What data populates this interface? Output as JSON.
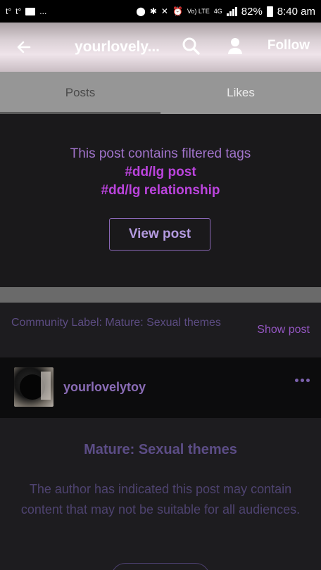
{
  "status_bar": {
    "left_icons": [
      "t-notification-icon",
      "t-notification-icon",
      "folder-icon",
      "more-icon"
    ],
    "left_texts": [
      "t°",
      "t°",
      "..."
    ],
    "battery": "82%",
    "time": "8:40 am",
    "network": "4G",
    "volte": "Vo) LTE"
  },
  "header": {
    "title": "yourlovely...",
    "follow_label": "Follow"
  },
  "tabs": [
    {
      "label": "Posts",
      "active": true
    },
    {
      "label": "Likes",
      "active": false
    }
  ],
  "filtered_post": {
    "message": "This post contains filtered tags",
    "tags": [
      "#dd/lg post",
      "#dd/lg relationship"
    ],
    "button_label": "View post"
  },
  "community": {
    "label": "Community Label: Mature: Sexual themes",
    "show_label": "Show post"
  },
  "author": {
    "name": "yourlovelytoy"
  },
  "mature_notice": {
    "heading": "Mature: Sexual themes",
    "body": "The author has indicated this post may contain content that may not be suitable for all audiences."
  },
  "colors": {
    "accent": "#bb44dd",
    "muted_purple": "#5c4d86",
    "tab_bar": "#969696"
  }
}
